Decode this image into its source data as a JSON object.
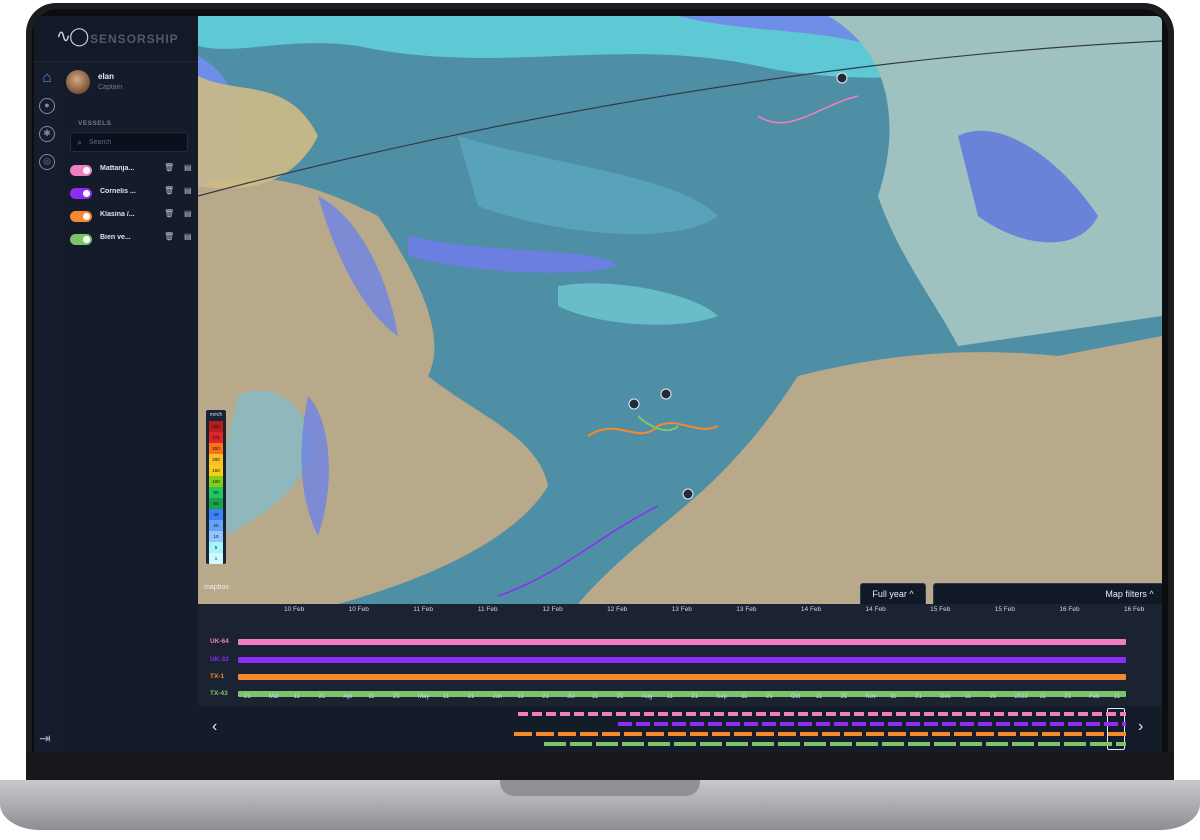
{
  "brand": {
    "name": "SENSORSHIP",
    "logo": "wave-logo-icon"
  },
  "user": {
    "name": "elan",
    "role": "Captain"
  },
  "rail": {
    "icons": [
      "home-icon",
      "user-icon",
      "settings-icon",
      "globe-icon"
    ],
    "logout": "logout-icon"
  },
  "vessels": {
    "title": "VESSELS",
    "search_placeholder": "Search",
    "items": [
      {
        "name": "Mattanja...",
        "color": "#f07fbf"
      },
      {
        "name": "Cornelis ...",
        "color": "#8c2cf5"
      },
      {
        "name": "Klasina /...",
        "color": "#f5892c"
      },
      {
        "name": "Bien ve...",
        "color": "#7cc46a"
      }
    ]
  },
  "map": {
    "attribution": "mapbox",
    "legend": {
      "title": "mm/h",
      "steps": [
        {
          "label": "300",
          "color": "#b91c1c"
        },
        {
          "label": "275",
          "color": "#dc2626"
        },
        {
          "label": "250",
          "color": "#f97316"
        },
        {
          "label": "200",
          "color": "#fbbf24"
        },
        {
          "label": "150",
          "color": "#facc15"
        },
        {
          "label": "100",
          "color": "#84cc16"
        },
        {
          "label": "80",
          "color": "#22c55e"
        },
        {
          "label": "60",
          "color": "#16a34a"
        },
        {
          "label": "40",
          "color": "#3b82f6"
        },
        {
          "label": "20",
          "color": "#60a5fa"
        },
        {
          "label": "10",
          "color": "#93c5fd"
        },
        {
          "label": "5",
          "color": "#a5f3fc"
        },
        {
          "label": "1",
          "color": "#cffafe"
        }
      ]
    },
    "buttons": {
      "full_year": "Full year ^",
      "map_filters": "Map filters ^"
    }
  },
  "timeline": {
    "dates": [
      "10 Feb",
      "10 Feb",
      "11 Feb",
      "11 Feb",
      "12 Feb",
      "12 Feb",
      "13 Feb",
      "13 Feb",
      "14 Feb",
      "14 Feb",
      "15 Feb",
      "15 Feb",
      "16 Feb",
      "16 Feb"
    ],
    "tracks": [
      {
        "label": "UK-64",
        "color": "#f07fbf"
      },
      {
        "label": "UK-33",
        "color": "#8c2cf5"
      },
      {
        "label": "TX-1",
        "color": "#f5892c"
      },
      {
        "label": "TX-43",
        "color": "#7cc46a"
      }
    ],
    "months": [
      "21",
      "Mar",
      "11",
      "21",
      "Apr",
      "11",
      "21",
      "May",
      "11",
      "21",
      "Jun",
      "11",
      "21",
      "Jul",
      "11",
      "21",
      "Aug",
      "11",
      "21",
      "Sep",
      "11",
      "21",
      "Oct",
      "11",
      "21",
      "Nov",
      "11",
      "21",
      "Dec",
      "11",
      "21",
      "2022",
      "11",
      "21",
      "Feb",
      "11"
    ],
    "prev": "‹",
    "next": "›"
  }
}
